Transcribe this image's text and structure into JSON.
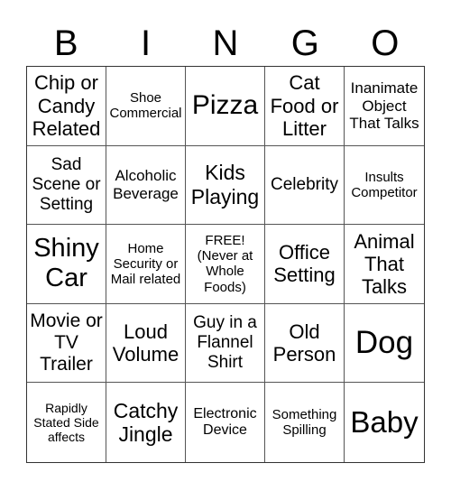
{
  "header": {
    "letters": [
      "B",
      "I",
      "N",
      "G",
      "O"
    ]
  },
  "cells": [
    "Chip or Candy Related",
    "Shoe Commercial",
    "Pizza",
    "Cat Food or Litter",
    "Inanimate Object That Talks",
    "Sad Scene or Setting",
    "Alcoholic Beverage",
    "Kids Playing",
    "Celebrity",
    "Insults Competitor",
    "Shiny Car",
    "Home Security or Mail related",
    "FREE! (Never at Whole Foods)",
    "Office Setting",
    "Animal That Talks",
    "Movie or TV Trailer",
    "Loud Volume",
    "Guy in a Flannel Shirt",
    "Old Person",
    "Dog",
    "Rapidly Stated Side affects",
    "Catchy Jingle",
    "Electronic Device",
    "Something Spilling",
    "Baby"
  ]
}
